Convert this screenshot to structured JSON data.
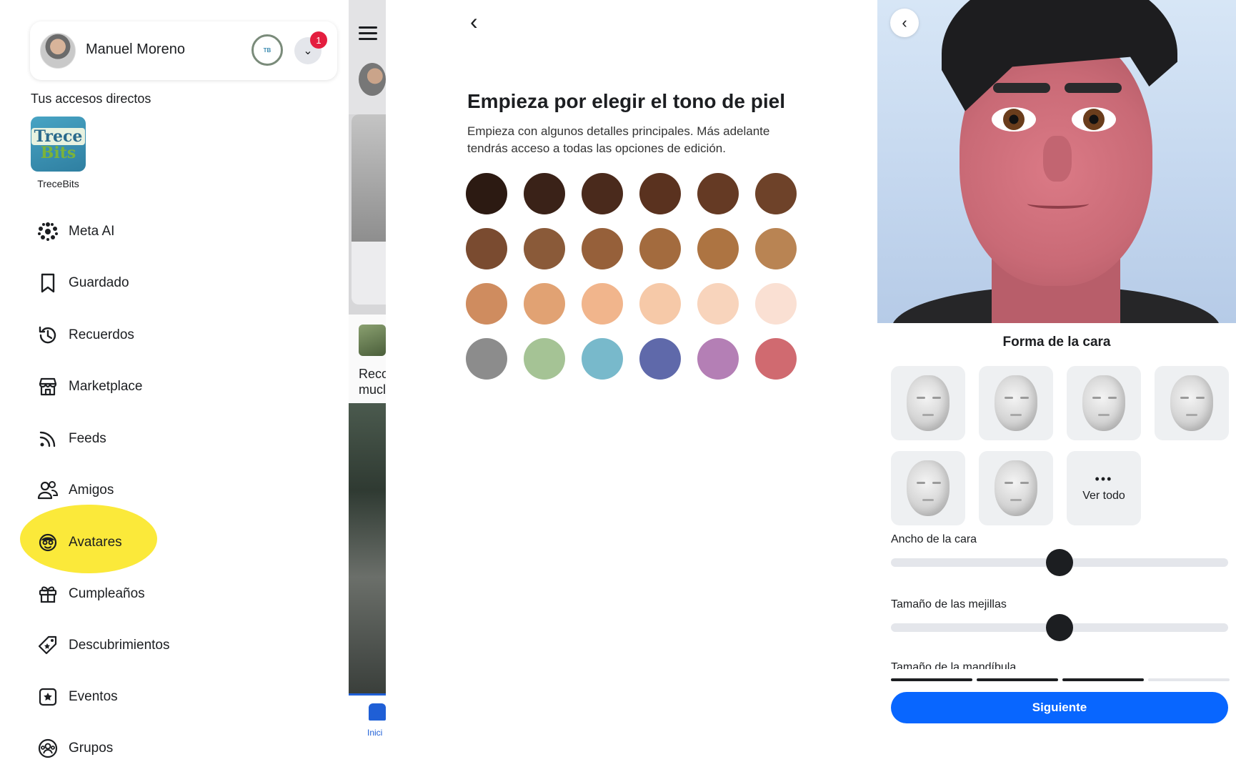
{
  "menu": {
    "profile_name": "Manuel Moreno",
    "notification_count": "1",
    "shortcuts_title": "Tus accesos directos",
    "shortcut": {
      "label": "TreceBits",
      "logo_top": "Trece",
      "logo_bottom": "Bits"
    },
    "items": [
      {
        "label": "Meta AI",
        "icon": "meta-ai-icon"
      },
      {
        "label": "Guardado",
        "icon": "bookmark-icon"
      },
      {
        "label": "Recuerdos",
        "icon": "clock-history-icon"
      },
      {
        "label": "Marketplace",
        "icon": "store-icon"
      },
      {
        "label": "Feeds",
        "icon": "feeds-icon"
      },
      {
        "label": "Amigos",
        "icon": "friends-icon"
      },
      {
        "label": "Avatares",
        "icon": "avatar-icon"
      },
      {
        "label": "Cumpleaños",
        "icon": "gift-icon"
      },
      {
        "label": "Descubrimientos",
        "icon": "tag-icon"
      },
      {
        "label": "Eventos",
        "icon": "calendar-star-icon"
      },
      {
        "label": "Grupos",
        "icon": "groups-icon"
      }
    ],
    "highlight_color": "#fbe93a"
  },
  "feed_strip": {
    "text_lines": [
      "Reco",
      "mucl"
    ],
    "nav_home_label": "Inici"
  },
  "skin_tone": {
    "title": "Empieza por elegir el tono de piel",
    "subtitle": "Empieza con algunos detalles principales. Más adelante tendrás acceso a todas las opciones de edición.",
    "swatches": [
      "#2c1a12",
      "#3a2218",
      "#4a2a1c",
      "#5a321f",
      "#653a24",
      "#6e4229",
      "#7a4b30",
      "#8a5a39",
      "#96603a",
      "#a36b3e",
      "#ad7442",
      "#b98453",
      "#cf8c5f",
      "#e1a273",
      "#f1b58c",
      "#f6c9a8",
      "#f8d4bc",
      "#fae0d3",
      "#8c8c8c",
      "#a5c395",
      "#78b9cb",
      "#5f69aa",
      "#b47fb5",
      "#d06a70"
    ]
  },
  "editor": {
    "section_title": "Forma de la cara",
    "face_shapes": [
      "face-shape-1",
      "face-shape-2",
      "face-shape-3",
      "face-shape-4",
      "face-shape-5",
      "face-shape-6"
    ],
    "see_all_label": "Ver todo",
    "sliders": [
      {
        "label": "Ancho de la cara",
        "value": 0.5
      },
      {
        "label": "Tamaño de las mejillas",
        "value": 0.5
      }
    ],
    "cut_off_label": "Tamaño de la mandíbula",
    "progress": {
      "total": 4,
      "completed": 3
    },
    "next_label": "Siguiente",
    "accent": "#0866ff"
  }
}
